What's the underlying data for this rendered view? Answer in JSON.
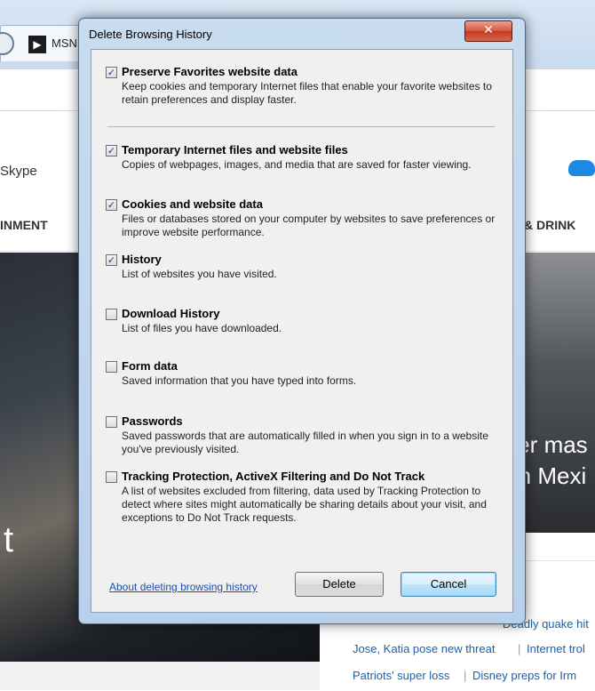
{
  "background": {
    "tab_icon": "MSN-icon",
    "tab_label": "MSN",
    "skype_label": "Skype",
    "nav_left": "INMENT",
    "nav_right": "& DRINK",
    "left_headline_fragment": "t",
    "right_headline_line1": "ter mas",
    "right_headline_line2": "rn Mexi",
    "links": [
      {
        "text": "Deadly quake hit"
      },
      {
        "text": "Jose, Katia pose new threat"
      },
      {
        "text": "Internet trol"
      },
      {
        "text": "Patriots' super loss"
      },
      {
        "text": "Disney preps for Irm"
      }
    ],
    "separator": "|"
  },
  "dialog": {
    "title": "Delete Browsing History",
    "close_glyph": "✕",
    "options": [
      {
        "title": "Preserve Favorites website data",
        "description": "Keep cookies and temporary Internet files that enable your favorite websites to retain preferences and display faster.",
        "checked": true
      },
      {
        "title": "Temporary Internet files and website files",
        "description": "Copies of webpages, images, and media that are saved for faster viewing.",
        "checked": true
      },
      {
        "title": "Cookies and website data",
        "description": "Files or databases stored on your computer by websites to save preferences or improve website performance.",
        "checked": true
      },
      {
        "title": "History",
        "description": "List of websites you have visited.",
        "checked": true
      },
      {
        "title": "Download History",
        "description": "List of files you have downloaded.",
        "checked": false
      },
      {
        "title": "Form data",
        "description": "Saved information that you have typed into forms.",
        "checked": false
      },
      {
        "title": "Passwords",
        "description": "Saved passwords that are automatically filled in when you sign in to a website you've previously visited.",
        "checked": false
      },
      {
        "title": "Tracking Protection, ActiveX Filtering and Do Not Track",
        "description": "A list of websites excluded from filtering, data used by Tracking Protection to detect where sites might automatically be sharing details about your visit, and exceptions to Do Not Track requests.",
        "checked": false
      }
    ],
    "check_glyph": "✓",
    "about_link": "About deleting browsing history",
    "delete_label": "Delete",
    "cancel_label": "Cancel"
  }
}
